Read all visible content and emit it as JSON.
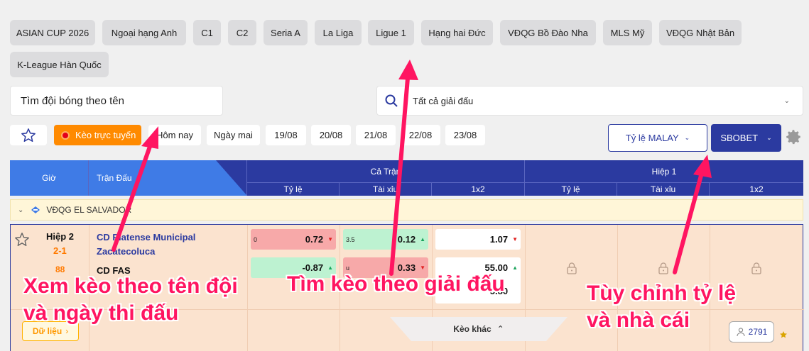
{
  "leagues": [
    "ASIAN CUP 2026",
    "Ngoại hạng Anh",
    "C1",
    "C2",
    "Seria A",
    "La Liga",
    "Ligue 1",
    "Hạng hai Đức",
    "VĐQG Bồ Đào Nha",
    "MLS Mỹ",
    "VĐQG Nhật Bản",
    "K-League Hàn Quốc"
  ],
  "search": {
    "placeholder": "Tìm đội bóng theo tên"
  },
  "league_select": {
    "value": "Tất cả giải đấu"
  },
  "filters": {
    "live_label": "Kèo trực tuyến",
    "dates": [
      "Hôm nay",
      "Ngày mai",
      "19/08",
      "20/08",
      "21/08",
      "22/08",
      "23/08"
    ]
  },
  "odds_type": "Tỷ lệ MALAY",
  "bookmaker": "SBOBET",
  "table": {
    "col_time": "Giờ",
    "col_match": "Trận Đấu",
    "group_full": "Cả Trận",
    "group_half": "Hiệp 1",
    "sub": [
      "Tỷ lệ",
      "Tài xỉu",
      "1x2",
      "Tỷ lệ",
      "Tài xỉu",
      "1x2"
    ]
  },
  "league_row": {
    "name": "VĐQG EL SALVADOR"
  },
  "match": {
    "period": "Hiệp 2",
    "score": "2-1",
    "minute": "88",
    "home": "CD Platense Municipal Zacatecoluca",
    "away": "CD FAS",
    "data_label": "Dữ liệu",
    "more_label": "Kèo khác",
    "viewers": "2791",
    "hdp": {
      "line": "0",
      "home": "0.72",
      "away": "-0.87"
    },
    "ou": {
      "line": "3.5",
      "over": "0.12",
      "under_tag": "u",
      "under": "0.33"
    },
    "x12": [
      "1.07",
      "55.00",
      "5.80"
    ]
  },
  "annotations": {
    "a1_l1": "Xem kèo theo tên đội",
    "a1_l2": "và ngày thi đấu",
    "a2": "Tìm kèo theo giải đấu",
    "a3_l1": "Tùy chỉnh tỷ lệ",
    "a3_l2": "và nhà cái"
  },
  "colors": {
    "accent": "#2b3aa0",
    "live": "#ff8a00",
    "annotation": "#ff1561",
    "header_blue": "#3f7be6"
  }
}
